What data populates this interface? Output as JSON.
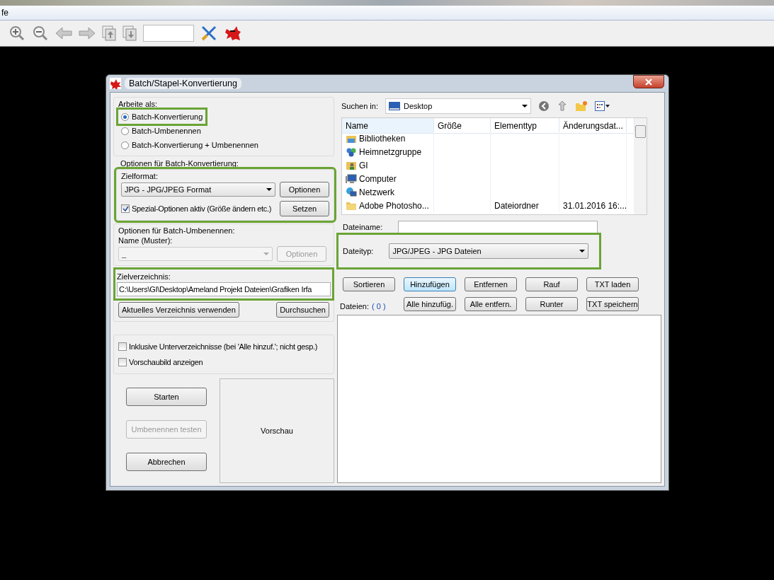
{
  "menu_bar": {
    "fragment": "fe"
  },
  "dialog": {
    "title": "Batch/Stapel-Konvertierung"
  },
  "work_as": {
    "label": "Arbeite als:",
    "options": [
      {
        "label": "Batch-Konvertierung",
        "selected": true,
        "highlighted": true
      },
      {
        "label": "Batch-Umbenennen",
        "selected": false,
        "highlighted": false
      },
      {
        "label": "Batch-Konvertierung + Umbenennen",
        "selected": false,
        "highlighted": false
      }
    ]
  },
  "conversion": {
    "heading": "Optionen für Batch-Konvertierung:",
    "highlighted": true,
    "format_label": "Zielformat:",
    "format": "JPG - JPG/JPEG Format",
    "options_button": "Optionen",
    "special_label": "Spezial-Optionen aktiv (Größe ändern etc.)",
    "special_checked": true,
    "set_button": "Setzen"
  },
  "rename": {
    "heading": "Optionen für Batch-Umbenennen:",
    "pattern_label": "Name (Muster):",
    "pattern": "_",
    "options_button": "Optionen",
    "disabled": true
  },
  "target": {
    "label": "Zielverzeichnis:",
    "highlighted": true,
    "path": "C:\\Users\\GI\\Desktop\\Ameland Projekt Dateien\\Grafiken Irfa",
    "use_current_button": "Aktuelles Verzeichnis verwenden",
    "browse_button": "Durchsuchen"
  },
  "checkboxes": [
    {
      "label": "Inklusive Unterverzeichnisse (bei 'Alle hinzuf.'; nicht gesp.)",
      "checked": false
    },
    {
      "label": "Vorschaubild anzeigen",
      "checked": false
    }
  ],
  "actions": [
    {
      "label": "Starten",
      "disabled": false
    },
    {
      "label": "Umbenennen testen",
      "disabled": true
    },
    {
      "label": "Abbrechen",
      "disabled": false
    }
  ],
  "preview": {
    "label": "Vorschau"
  },
  "browser": {
    "look_in_label": "Suchen in:",
    "location": "Desktop",
    "columns": [
      "Name",
      "Größe",
      "Elementtyp",
      "Änderungsdat..."
    ],
    "files": [
      {
        "name": "Bibliotheken",
        "kind": "library"
      },
      {
        "name": "Heimnetzgruppe",
        "kind": "homegroup"
      },
      {
        "name": "GI",
        "kind": "user"
      },
      {
        "name": "Computer",
        "kind": "computer"
      },
      {
        "name": "Netzwerk",
        "kind": "network"
      },
      {
        "name": "Adobe Photosho...",
        "kind": "folder",
        "type": "Dateiordner",
        "date": "31.01.2016 16:..."
      }
    ],
    "filename_label": "Dateiname:",
    "filetype_label": "Dateityp:",
    "filetype": "JPG/JPEG - JPG Dateien",
    "filetype_highlighted": true
  },
  "list_buttons": [
    {
      "label": "Sortieren",
      "focused": false
    },
    {
      "label": "Hinzufügen",
      "focused": true
    },
    {
      "label": "Entfernen",
      "focused": false
    },
    {
      "label": "Rauf",
      "focused": false
    },
    {
      "label": "TXT laden",
      "focused": false
    },
    {
      "label": "Alle hinzufüg.",
      "focused": false
    },
    {
      "label": "Alle entfern.",
      "focused": false
    },
    {
      "label": "Runter",
      "focused": false
    },
    {
      "label": "TXT speichern",
      "focused": false
    }
  ],
  "files_label": "Dateien:",
  "files_count": "( 0 )"
}
